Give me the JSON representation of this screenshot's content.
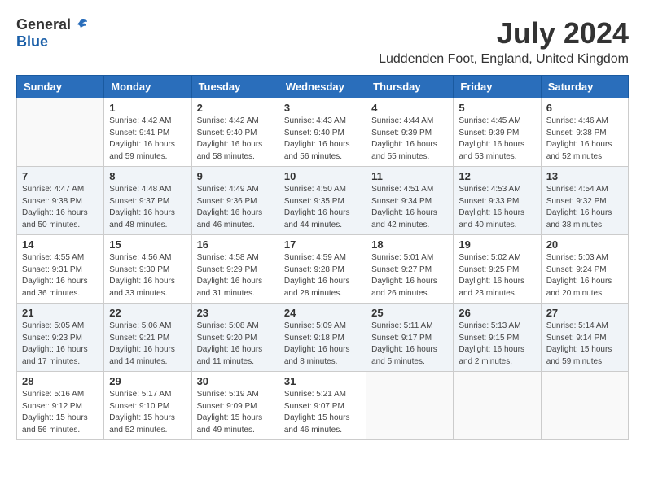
{
  "header": {
    "logo_general": "General",
    "logo_blue": "Blue",
    "month_title": "July 2024",
    "location": "Luddenden Foot, England, United Kingdom"
  },
  "weekdays": [
    "Sunday",
    "Monday",
    "Tuesday",
    "Wednesday",
    "Thursday",
    "Friday",
    "Saturday"
  ],
  "weeks": [
    [
      {
        "day": "",
        "info": ""
      },
      {
        "day": "1",
        "info": "Sunrise: 4:42 AM\nSunset: 9:41 PM\nDaylight: 16 hours\nand 59 minutes."
      },
      {
        "day": "2",
        "info": "Sunrise: 4:42 AM\nSunset: 9:40 PM\nDaylight: 16 hours\nand 58 minutes."
      },
      {
        "day": "3",
        "info": "Sunrise: 4:43 AM\nSunset: 9:40 PM\nDaylight: 16 hours\nand 56 minutes."
      },
      {
        "day": "4",
        "info": "Sunrise: 4:44 AM\nSunset: 9:39 PM\nDaylight: 16 hours\nand 55 minutes."
      },
      {
        "day": "5",
        "info": "Sunrise: 4:45 AM\nSunset: 9:39 PM\nDaylight: 16 hours\nand 53 minutes."
      },
      {
        "day": "6",
        "info": "Sunrise: 4:46 AM\nSunset: 9:38 PM\nDaylight: 16 hours\nand 52 minutes."
      }
    ],
    [
      {
        "day": "7",
        "info": "Sunrise: 4:47 AM\nSunset: 9:38 PM\nDaylight: 16 hours\nand 50 minutes."
      },
      {
        "day": "8",
        "info": "Sunrise: 4:48 AM\nSunset: 9:37 PM\nDaylight: 16 hours\nand 48 minutes."
      },
      {
        "day": "9",
        "info": "Sunrise: 4:49 AM\nSunset: 9:36 PM\nDaylight: 16 hours\nand 46 minutes."
      },
      {
        "day": "10",
        "info": "Sunrise: 4:50 AM\nSunset: 9:35 PM\nDaylight: 16 hours\nand 44 minutes."
      },
      {
        "day": "11",
        "info": "Sunrise: 4:51 AM\nSunset: 9:34 PM\nDaylight: 16 hours\nand 42 minutes."
      },
      {
        "day": "12",
        "info": "Sunrise: 4:53 AM\nSunset: 9:33 PM\nDaylight: 16 hours\nand 40 minutes."
      },
      {
        "day": "13",
        "info": "Sunrise: 4:54 AM\nSunset: 9:32 PM\nDaylight: 16 hours\nand 38 minutes."
      }
    ],
    [
      {
        "day": "14",
        "info": "Sunrise: 4:55 AM\nSunset: 9:31 PM\nDaylight: 16 hours\nand 36 minutes."
      },
      {
        "day": "15",
        "info": "Sunrise: 4:56 AM\nSunset: 9:30 PM\nDaylight: 16 hours\nand 33 minutes."
      },
      {
        "day": "16",
        "info": "Sunrise: 4:58 AM\nSunset: 9:29 PM\nDaylight: 16 hours\nand 31 minutes."
      },
      {
        "day": "17",
        "info": "Sunrise: 4:59 AM\nSunset: 9:28 PM\nDaylight: 16 hours\nand 28 minutes."
      },
      {
        "day": "18",
        "info": "Sunrise: 5:01 AM\nSunset: 9:27 PM\nDaylight: 16 hours\nand 26 minutes."
      },
      {
        "day": "19",
        "info": "Sunrise: 5:02 AM\nSunset: 9:25 PM\nDaylight: 16 hours\nand 23 minutes."
      },
      {
        "day": "20",
        "info": "Sunrise: 5:03 AM\nSunset: 9:24 PM\nDaylight: 16 hours\nand 20 minutes."
      }
    ],
    [
      {
        "day": "21",
        "info": "Sunrise: 5:05 AM\nSunset: 9:23 PM\nDaylight: 16 hours\nand 17 minutes."
      },
      {
        "day": "22",
        "info": "Sunrise: 5:06 AM\nSunset: 9:21 PM\nDaylight: 16 hours\nand 14 minutes."
      },
      {
        "day": "23",
        "info": "Sunrise: 5:08 AM\nSunset: 9:20 PM\nDaylight: 16 hours\nand 11 minutes."
      },
      {
        "day": "24",
        "info": "Sunrise: 5:09 AM\nSunset: 9:18 PM\nDaylight: 16 hours\nand 8 minutes."
      },
      {
        "day": "25",
        "info": "Sunrise: 5:11 AM\nSunset: 9:17 PM\nDaylight: 16 hours\nand 5 minutes."
      },
      {
        "day": "26",
        "info": "Sunrise: 5:13 AM\nSunset: 9:15 PM\nDaylight: 16 hours\nand 2 minutes."
      },
      {
        "day": "27",
        "info": "Sunrise: 5:14 AM\nSunset: 9:14 PM\nDaylight: 15 hours\nand 59 minutes."
      }
    ],
    [
      {
        "day": "28",
        "info": "Sunrise: 5:16 AM\nSunset: 9:12 PM\nDaylight: 15 hours\nand 56 minutes."
      },
      {
        "day": "29",
        "info": "Sunrise: 5:17 AM\nSunset: 9:10 PM\nDaylight: 15 hours\nand 52 minutes."
      },
      {
        "day": "30",
        "info": "Sunrise: 5:19 AM\nSunset: 9:09 PM\nDaylight: 15 hours\nand 49 minutes."
      },
      {
        "day": "31",
        "info": "Sunrise: 5:21 AM\nSunset: 9:07 PM\nDaylight: 15 hours\nand 46 minutes."
      },
      {
        "day": "",
        "info": ""
      },
      {
        "day": "",
        "info": ""
      },
      {
        "day": "",
        "info": ""
      }
    ]
  ]
}
